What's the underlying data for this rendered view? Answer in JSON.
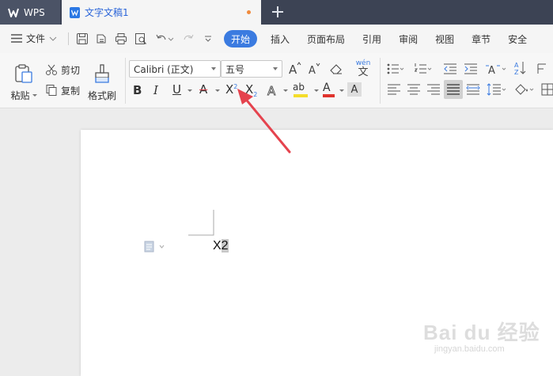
{
  "titlebar": {
    "app_label": "WPS",
    "doc_tab_label": "文字文稿1",
    "new_tab_symbol": "+"
  },
  "menubar": {
    "file_label": "文件",
    "tabs": [
      {
        "label": "开始",
        "active": true
      },
      {
        "label": "插入"
      },
      {
        "label": "页面布局"
      },
      {
        "label": "引用"
      },
      {
        "label": "审阅"
      },
      {
        "label": "视图"
      },
      {
        "label": "章节"
      },
      {
        "label": "安全"
      }
    ]
  },
  "ribbon": {
    "paste_label": "粘贴",
    "cut_label": "剪切",
    "copy_label": "复制",
    "format_painter_label": "格式刷",
    "font_name": "Calibri (正文)",
    "font_size": "五号",
    "bold_label": "B",
    "italic_label": "I",
    "underline_label": "U",
    "strike_label": "A",
    "superscript_label": "X",
    "superscript_mark": "2",
    "subscript_label": "X",
    "subscript_mark": "2",
    "font_color_letter": "A",
    "highlight_label": "ab",
    "pinyin_label": "wén"
  },
  "document": {
    "text_main": "X",
    "text_selected": "2"
  },
  "watermark": {
    "brand": "Bai du 经验",
    "url": "jingyan.baidu.com"
  },
  "colors": {
    "accent": "#3b7be0",
    "arrow": "#e5434e",
    "titlebar": "#3c4354"
  }
}
